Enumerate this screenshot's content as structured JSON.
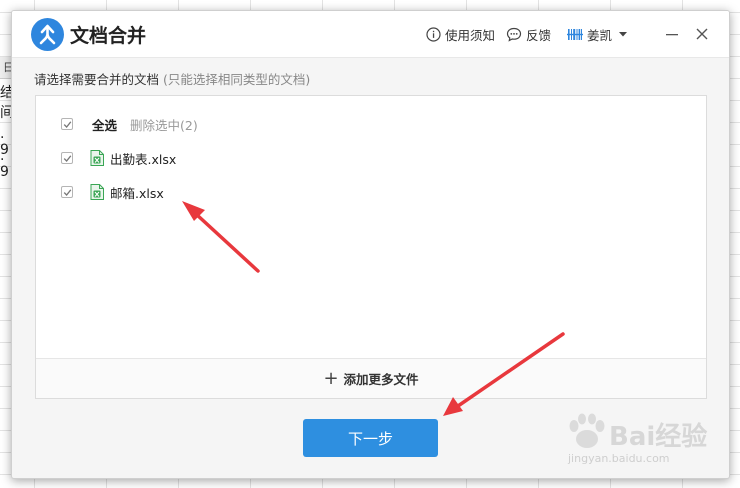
{
  "background": {
    "header_fragment": "日",
    "fragments": [
      "结",
      "间",
      ". 9",
      ". 9"
    ]
  },
  "titlebar": {
    "title": "文档合并",
    "help_label": "使用须知",
    "feedback_label": "反馈",
    "user_name": "姜凯",
    "icons": {
      "logo": "merge-icon",
      "help": "info-circle-icon",
      "feedback": "chat-bubble-icon",
      "user": "barcode-avatar-icon",
      "minimize": "minimize-icon",
      "close": "close-icon"
    }
  },
  "instruction": {
    "text": "请选择需要合并的文档",
    "hint": "(只能选择相同类型的文档)"
  },
  "file_list": {
    "select_all_label": "全选",
    "delete_selected_label": "删除选中(2)",
    "files": [
      {
        "name": "出勤表.xlsx",
        "checked": true,
        "icon": "excel-file-icon"
      },
      {
        "name": "邮箱.xlsx",
        "checked": true,
        "icon": "excel-file-icon"
      }
    ],
    "add_more_label": "添加更多文件"
  },
  "next_button": {
    "label": "下一步"
  },
  "colors": {
    "accent": "#2e8fe0",
    "annotation_arrow": "#e8383d",
    "excel_green": "#3aa655"
  },
  "watermark": {
    "main": "Bai经验",
    "sub": "jingyan.baidu.com"
  }
}
